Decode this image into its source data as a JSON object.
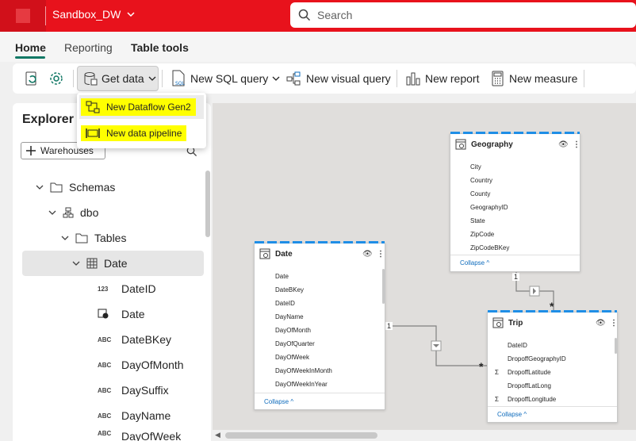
{
  "app": {
    "workspace": "Sandbox_DW",
    "search_placeholder": "Search"
  },
  "tabs": [
    {
      "label": "Home"
    },
    {
      "label": "Reporting"
    },
    {
      "label": "Table tools"
    }
  ],
  "toolbar": {
    "get_data": "Get data",
    "new_sql_query": "New SQL query",
    "new_visual_query": "New visual query",
    "new_report": "New report",
    "new_measure": "New measure"
  },
  "get_data_menu": [
    {
      "label": "New Dataflow Gen2"
    },
    {
      "label": "New data pipeline"
    }
  ],
  "explorer": {
    "title": "Explorer",
    "warehouses_button": "Warehouses",
    "tree": {
      "schemas": "Schemas",
      "dbo": "dbo",
      "tables": "Tables",
      "date": "Date"
    },
    "columns": [
      {
        "type": "123",
        "name": "DateID"
      },
      {
        "type": "",
        "name": "Date"
      },
      {
        "type": "ABC",
        "name": "DateBKey"
      },
      {
        "type": "ABC",
        "name": "DayOfMonth"
      },
      {
        "type": "ABC",
        "name": "DaySuffix"
      },
      {
        "type": "ABC",
        "name": "DayName"
      },
      {
        "type": "ABC",
        "name": "DayOfWeek"
      }
    ]
  },
  "model": {
    "geography": {
      "title": "Geography",
      "fields": [
        "City",
        "Country",
        "County",
        "GeographyID",
        "State",
        "ZipCode",
        "ZipCodeBKey"
      ],
      "collapse": "Collapse"
    },
    "date": {
      "title": "Date",
      "fields": [
        "Date",
        "DateBKey",
        "DateID",
        "DayName",
        "DayOfMonth",
        "DayOfQuarter",
        "DayOfWeek",
        "DayOfWeekInMonth",
        "DayOfWeekInYear"
      ],
      "collapse": "Collapse"
    },
    "trip": {
      "title": "Trip",
      "fields": [
        "DateID",
        "DropoffGeographyID",
        "DropoffLatitude",
        "DropoffLatLong",
        "DropoffLongitude"
      ],
      "collapse": "Collapse"
    },
    "rel": {
      "one": "1",
      "many": "*"
    }
  },
  "colors": {
    "brand": "#e8121c",
    "accent": "#117865",
    "highlight": "#ffff00"
  }
}
